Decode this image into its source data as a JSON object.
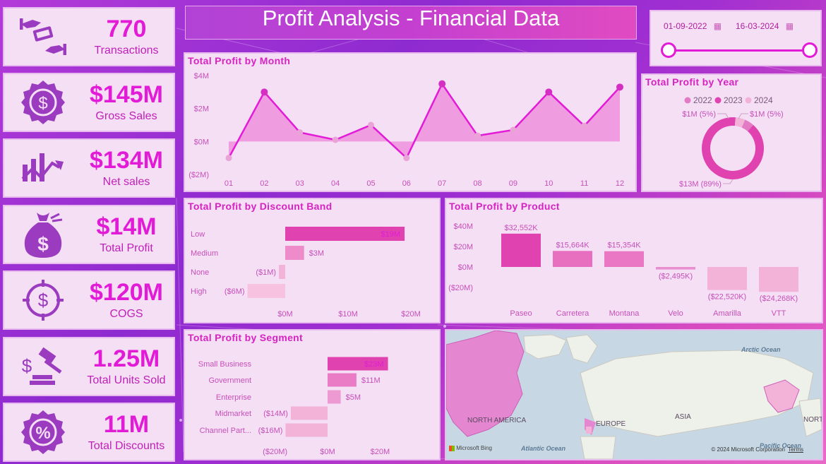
{
  "dashboard": {
    "title": "Profit Analysis - Financial Data"
  },
  "kpis": [
    {
      "value": "770",
      "label": "Transactions",
      "icon": "money-exchange-icon"
    },
    {
      "value": "$145M",
      "label": "Gross Sales",
      "icon": "dollar-badge-icon"
    },
    {
      "value": "$134M",
      "label": "Net sales",
      "icon": "growth-chart-icon"
    },
    {
      "value": "$14M",
      "label": "Total Profit",
      "icon": "money-bag-icon"
    },
    {
      "value": "$120M",
      "label": "COGS",
      "icon": "dollar-target-icon"
    },
    {
      "value": "1.25M",
      "label": "Total Units Sold",
      "icon": "gavel-dollar-icon"
    },
    {
      "value": "11M",
      "label": "Total Discounts",
      "icon": "percent-badge-icon"
    }
  ],
  "date_slicer": {
    "start": "01-09-2022",
    "end": "16-03-2024",
    "icon": "calendar-icon"
  },
  "colors": {
    "accent": "#e21bd6",
    "pink_dark": "#e043b0",
    "pink_mid": "#ee86c9",
    "pink_light": "#f6b6dd",
    "card": "#f5dff5"
  },
  "chart_data": [
    {
      "id": "profit_by_month",
      "type": "area",
      "title": "Total Profit by Month",
      "categories": [
        "01",
        "02",
        "03",
        "04",
        "05",
        "06",
        "07",
        "08",
        "09",
        "10",
        "11",
        "12"
      ],
      "values": [
        -1.0,
        3.0,
        0.55,
        0.1,
        1.0,
        -1.0,
        3.5,
        0.35,
        0.7,
        3.0,
        0.95,
        3.3
      ],
      "ylim": [
        -2,
        4
      ],
      "yticks": [
        "($2M)",
        "$0M",
        "$2M",
        "$4M"
      ],
      "ytick_values": [
        -2,
        0,
        2,
        4
      ]
    },
    {
      "id": "profit_by_year",
      "type": "pie",
      "title": "Total Profit by Year",
      "legend": [
        "2022",
        "2023",
        "2024"
      ],
      "values": [
        0.7,
        12.6,
        0.7
      ],
      "labels": [
        "$1M (5%)",
        "$13M (89%)",
        "$1M (5%)"
      ],
      "colors": [
        "#e37bc4",
        "#e043b0",
        "#f3b3d9"
      ]
    },
    {
      "id": "profit_by_discount_band",
      "type": "bar",
      "title": "Total Profit by Discount Band",
      "orientation": "horizontal",
      "categories": [
        "Low",
        "Medium",
        "None",
        "High"
      ],
      "values": [
        19,
        3,
        -1,
        -6
      ],
      "labels": [
        "$19M",
        "$3M",
        "($1M)",
        "($6M)"
      ],
      "xlim": [
        -6,
        20
      ],
      "xticks": [
        "$0M",
        "$10M",
        "$20M"
      ],
      "xtick_values": [
        0,
        10,
        20
      ]
    },
    {
      "id": "profit_by_product",
      "type": "bar",
      "title": "Total Profit by Product",
      "categories": [
        "Paseo",
        "Carretera",
        "Montana",
        "Velo",
        "Amarilla",
        "VTT"
      ],
      "values": [
        32552,
        15664,
        15354,
        -2495,
        -22520,
        -24268
      ],
      "labels": [
        "$32,552K",
        "$15,664K",
        "$15,354K",
        "($2,495K)",
        "($22,520K)",
        "($24,268K)"
      ],
      "ylim": [
        -20000,
        40000
      ],
      "yticks": [
        "($20M)",
        "$0M",
        "$20M",
        "$40M"
      ],
      "ytick_values": [
        -20000,
        0,
        20000,
        40000
      ]
    },
    {
      "id": "profit_by_segment",
      "type": "bar",
      "title": "Total Profit by Segment",
      "orientation": "horizontal",
      "categories": [
        "Small Business",
        "Government",
        "Enterprise",
        "Midmarket",
        "Channel Part..."
      ],
      "values": [
        23,
        11,
        5,
        -14,
        -16
      ],
      "labels": [
        "$23M",
        "$11M",
        "$5M",
        "($14M)",
        "($16M)"
      ],
      "xlim": [
        -20,
        25
      ],
      "xticks": [
        "($20M)",
        "$0M",
        "$20M"
      ],
      "xtick_values": [
        -20,
        0,
        20
      ]
    }
  ],
  "map": {
    "labels": [
      "Arctic Ocean",
      "NORTH AMERICA",
      "EUROPE",
      "ASIA",
      "NORTH",
      "Atlantic Ocean",
      "Pacific Ocean"
    ],
    "attribution": "© 2024 Microsoft Corporation",
    "terms": "Terms",
    "brand": "Microsoft Bing"
  }
}
